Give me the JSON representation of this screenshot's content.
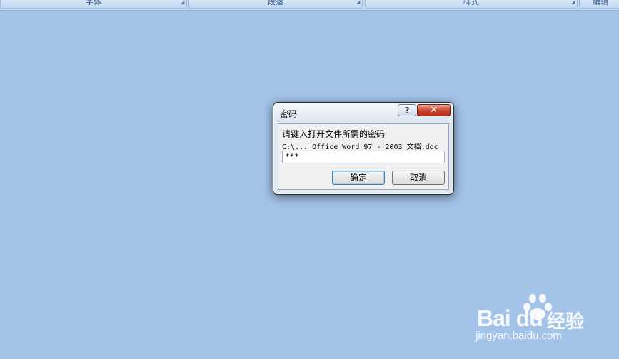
{
  "ribbon": {
    "groups": [
      {
        "label": "字体"
      },
      {
        "label": "段落"
      },
      {
        "label": "样式"
      },
      {
        "label": "编辑"
      }
    ]
  },
  "dialog": {
    "title": "密码",
    "help_label": "?",
    "close_label": "✕",
    "prompt": "请键入打开文件所需的密码",
    "file_path": "C:\\... Office Word 97 - 2003 文档.doc",
    "password_value": "***",
    "ok_label": "确定",
    "cancel_label": "取消"
  },
  "watermark": {
    "logo": "Bai  du",
    "jingyan": "经验",
    "url": "jingyan.baidu.com"
  },
  "colors": {
    "background": "#a3c3e9",
    "close_button": "#c8402a"
  }
}
